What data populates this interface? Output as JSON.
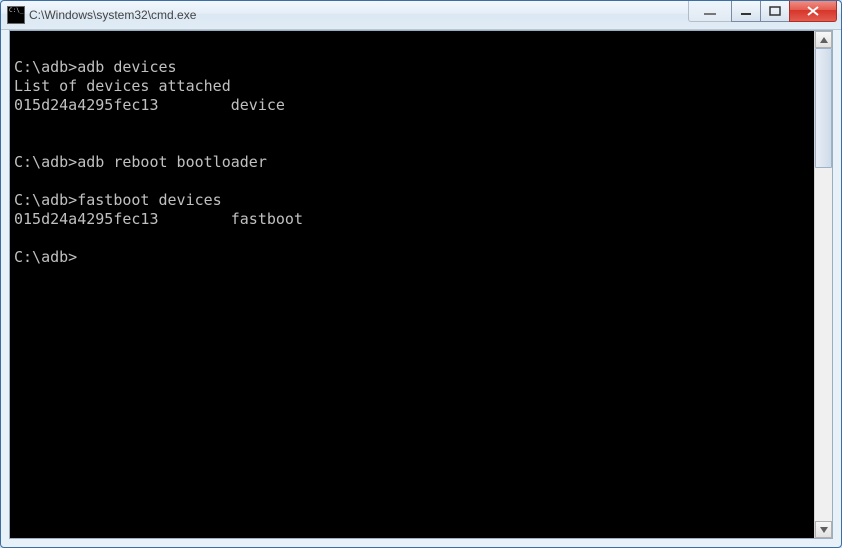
{
  "window": {
    "title": "C:\\Windows\\system32\\cmd.exe"
  },
  "terminal": {
    "lines": [
      "",
      "C:\\adb>adb devices",
      "List of devices attached",
      "015d24a4295fec13        device",
      "",
      "",
      "C:\\adb>adb reboot bootloader",
      "",
      "C:\\adb>fastboot devices",
      "015d24a4295fec13        fastboot",
      "",
      "C:\\adb>"
    ]
  }
}
